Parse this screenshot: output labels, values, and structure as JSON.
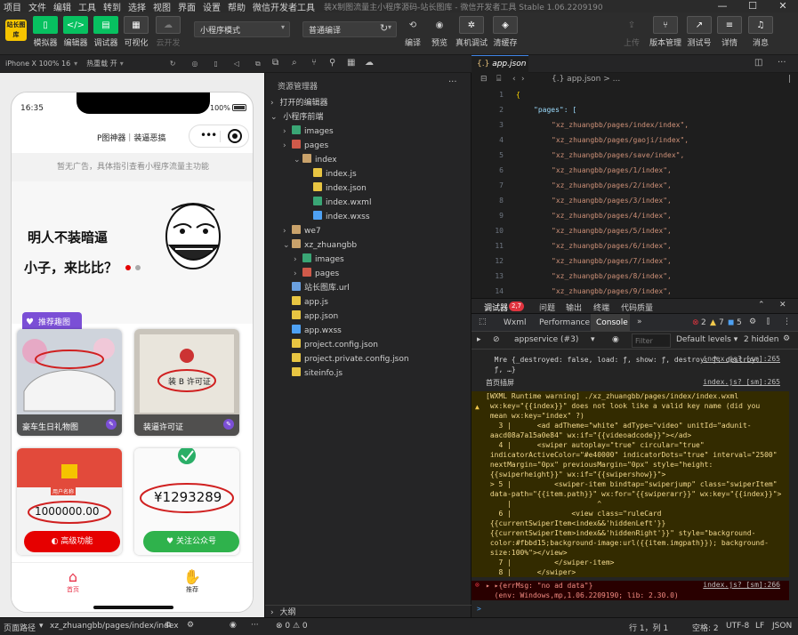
{
  "menu": {
    "items": [
      "项目",
      "文件",
      "编辑",
      "工具",
      "转到",
      "选择",
      "视图",
      "界面",
      "设置",
      "帮助",
      "微信开发者工具"
    ],
    "window_title": "装X制图流量主小程序源码-站长图库 - 微信开发者工具 Stable 1.06.2209190"
  },
  "toolbar": {
    "logo": "站长图库",
    "simulator": "模拟器",
    "editor": "编辑器",
    "debugger": "调试器",
    "visual": "可视化",
    "cloud": "云开发",
    "mode_select": "小程序模式",
    "compile_select": "普通编译",
    "compile": "编译",
    "preview": "预览",
    "real_debug": "真机调试",
    "clear_cache": "清缓存",
    "upload": "上传",
    "version": "版本管理",
    "test": "测试号",
    "details": "详情",
    "messages": "消息"
  },
  "simbar": {
    "device": "iPhone X 100% 16",
    "hotreload": "热重载 开"
  },
  "phone": {
    "time": "16:35",
    "battery": "100%",
    "nav_title": "P图神器｜装逼恶搞",
    "ad_text": "暂无广告，具体指引查看小程序流量主功能",
    "hero_line1": "明人不装暗逼",
    "hero_line2": "小子，来比比？",
    "recommend": "推荐趣图",
    "card1_label": "豪车生日礼物图",
    "card2_label": "装逼许可证",
    "card2_stamp": "装 B 许可证",
    "card3_amount": "1000000.00",
    "card3_tag": "用户名称",
    "card4_amount": "¥1293289",
    "btn_advanced": "高级功能",
    "btn_follow": "关注公众号",
    "tab_home": "首页",
    "tab_like": "推荐"
  },
  "explorer": {
    "title": "资源管理器",
    "open_editors": "打开的编辑器",
    "project": "小程序前端",
    "tree": [
      {
        "label": "images",
        "indent": 1,
        "kind": "folder-img"
      },
      {
        "label": "pages",
        "indent": 1,
        "kind": "folder-red"
      },
      {
        "label": "index",
        "indent": 2,
        "kind": "folder-open"
      },
      {
        "label": "index.js",
        "indent": 3,
        "kind": "js"
      },
      {
        "label": "index.json",
        "indent": 3,
        "kind": "json"
      },
      {
        "label": "index.wxml",
        "indent": 3,
        "kind": "wxml"
      },
      {
        "label": "index.wxss",
        "indent": 3,
        "kind": "wxss"
      },
      {
        "label": "we7",
        "indent": 1,
        "kind": "folder"
      },
      {
        "label": "xz_zhuangbb",
        "indent": 1,
        "kind": "folder-open"
      },
      {
        "label": "images",
        "indent": 2,
        "kind": "folder-img"
      },
      {
        "label": "pages",
        "indent": 2,
        "kind": "folder-red"
      },
      {
        "label": "站长图库.url",
        "indent": 1,
        "kind": "link"
      },
      {
        "label": "app.js",
        "indent": 1,
        "kind": "js"
      },
      {
        "label": "app.json",
        "indent": 1,
        "kind": "json"
      },
      {
        "label": "app.wxss",
        "indent": 1,
        "kind": "wxss"
      },
      {
        "label": "project.config.json",
        "indent": 1,
        "kind": "json"
      },
      {
        "label": "project.private.config.json",
        "indent": 1,
        "kind": "json"
      },
      {
        "label": "siteinfo.js",
        "indent": 1,
        "kind": "js"
      }
    ],
    "outline": "大纲"
  },
  "editor": {
    "tab": "app.json",
    "crumb": "{.} app.json > ...",
    "lines": [
      {
        "n": "1",
        "t": "{"
      },
      {
        "n": "2",
        "t": "\"pages\": ["
      },
      {
        "n": "3",
        "t": "\"xz_zhuangbb/pages/index/index\","
      },
      {
        "n": "4",
        "t": "\"xz_zhuangbb/pages/gaoji/index\","
      },
      {
        "n": "5",
        "t": "\"xz_zhuangbb/pages/save/index\","
      },
      {
        "n": "6",
        "t": "\"xz_zhuangbb/pages/1/index\","
      },
      {
        "n": "7",
        "t": "\"xz_zhuangbb/pages/2/index\","
      },
      {
        "n": "8",
        "t": "\"xz_zhuangbb/pages/3/index\","
      },
      {
        "n": "9",
        "t": "\"xz_zhuangbb/pages/4/index\","
      },
      {
        "n": "10",
        "t": "\"xz_zhuangbb/pages/5/index\","
      },
      {
        "n": "11",
        "t": "\"xz_zhuangbb/pages/6/index\","
      },
      {
        "n": "12",
        "t": "\"xz_zhuangbb/pages/7/index\","
      },
      {
        "n": "13",
        "t": "\"xz_zhuangbb/pages/8/index\","
      },
      {
        "n": "14",
        "t": "\"xz_zhuangbb/pages/9/index\","
      }
    ]
  },
  "debugger": {
    "tabs": [
      "调试器",
      "问题",
      "输出",
      "终端",
      "代码质量"
    ],
    "badge": "2,7",
    "con_tabs": [
      "Wxml",
      "Performance",
      "Console"
    ],
    "errors": "2",
    "warnings": "7",
    "infos": "5",
    "context": "appservice (#3)",
    "filter_placeholder": "Filter",
    "levels": "Default levels",
    "hidden": "2 hidden",
    "lines": [
      {
        "text": "  Mre {_destroyed: false, load: ƒ, show: ƒ, destroy: ƒ, destroy:",
        "src": "index.js? [sm]:265"
      },
      {
        "text": "  ƒ, …}",
        "src": ""
      },
      {
        "text": "首页插屏",
        "src": "index.js? [sm]:265"
      },
      {
        "text": "[WXML Runtime warning] ./xz_zhuangbb/pages/index/index.wxml",
        "src": ""
      },
      {
        "text": " wx:key=\"{{index}}\" does not look like a valid key name (did you",
        "src": ""
      },
      {
        "text": " mean wx:key=\"index\" ?)",
        "src": ""
      },
      {
        "text": "   3 |      <ad adTheme=\"white\" adType=\"video\" unitId=\"adunit-",
        "src": ""
      },
      {
        "text": " aacd08a7a15a0e84\" wx:if=\"{{videoadcode}}\"></ad>",
        "src": ""
      },
      {
        "text": "   4 |      <swiper autoplay=\"true\" circular=\"true\"",
        "src": ""
      },
      {
        "text": " indicatorActiveColor=\"#e40000\" indicatorDots=\"true\" interval=\"2500\"",
        "src": ""
      },
      {
        "text": " nextMargin=\"0px\" previousMargin=\"0px\" style=\"height:",
        "src": ""
      },
      {
        "text": " {{swiperheight}}\" wx:if=\"{{swipershow}}\">",
        "src": ""
      },
      {
        "text": " > 5 |          <swiper-item bindtap=\"swiperjump\" class=\"swiperItem\"",
        "src": ""
      },
      {
        "text": " data-path=\"{{item.path}}\" wx:for=\"{{swiperarr}}\" wx:key=\"{{index}}\">",
        "src": ""
      },
      {
        "text": "     |                    ^",
        "src": ""
      },
      {
        "text": "   6 |              <view class=\"ruleCard",
        "src": ""
      },
      {
        "text": " {{currentSwiperItem<index&&'hiddenLeft'}}",
        "src": ""
      },
      {
        "text": " {{currentSwiperItem>index&&'hiddenRight'}}\" style=\"background-",
        "src": ""
      },
      {
        "text": " color:#fbbd15;background-image:url({{item.imgpath}}); background-",
        "src": ""
      },
      {
        "text": " size:100%\"></view>",
        "src": ""
      },
      {
        "text": "   7 |          </swiper-item>",
        "src": ""
      },
      {
        "text": "   8 |      </swiper>",
        "src": ""
      },
      {
        "text": "▸ ▸{errMsg: \"no ad data\"}",
        "src": "index.js? [sm]:266"
      },
      {
        "text": "  (env: Windows,mp,1.06.2209190; lib: 2.30.0)",
        "src": ""
      }
    ],
    "prompt": ">"
  },
  "statusbar": {
    "path_label": "页面路径",
    "path": "xz_zhuangbb/pages/index/index",
    "problems": "⊗ 0 ⚠ 0",
    "position": "行 1，列 1",
    "spaces": "空格: 2",
    "encoding": "UTF-8",
    "eol": "LF",
    "lang": "JSON"
  },
  "colors": {
    "accent_green": "#07c160",
    "error_red": "#e0343f",
    "warning_bg": "#332b00",
    "error_bg": "#290000",
    "purple": "#7b4fd6"
  }
}
